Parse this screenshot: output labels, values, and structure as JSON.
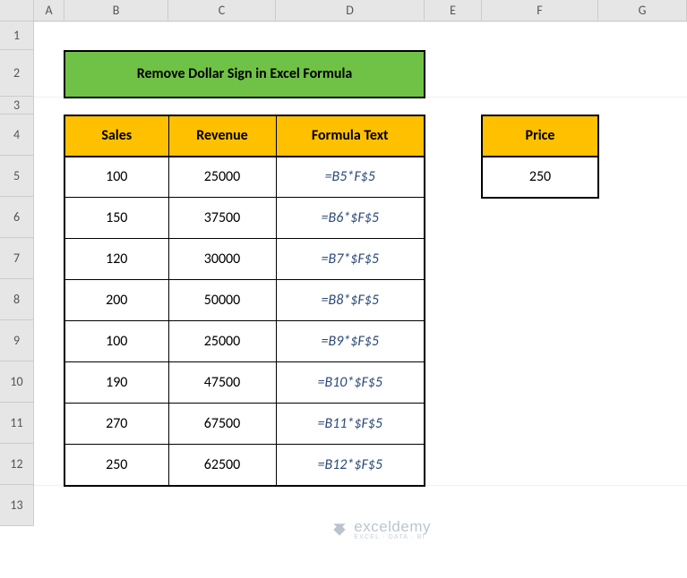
{
  "columns": [
    "A",
    "B",
    "C",
    "D",
    "E",
    "F",
    "G"
  ],
  "rows": [
    "1",
    "2",
    "3",
    "4",
    "5",
    "6",
    "7",
    "8",
    "9",
    "10",
    "11",
    "12",
    "13"
  ],
  "title": "Remove Dollar Sign in Excel Formula",
  "headers": {
    "sales": "Sales",
    "revenue": "Revenue",
    "formula_text": "Formula Text",
    "price": "Price"
  },
  "price_value": "250",
  "chart_data": {
    "type": "table",
    "title": "Remove Dollar Sign in Excel Formula",
    "columns": [
      "Sales",
      "Revenue",
      "Formula Text"
    ],
    "rows": [
      {
        "sales": 100,
        "revenue": 25000,
        "formula": "=B5*F$5"
      },
      {
        "sales": 150,
        "revenue": 37500,
        "formula": "=B6*$F$5"
      },
      {
        "sales": 120,
        "revenue": 30000,
        "formula": "=B7*$F$5"
      },
      {
        "sales": 200,
        "revenue": 50000,
        "formula": "=B8*$F$5"
      },
      {
        "sales": 100,
        "revenue": 25000,
        "formula": "=B9*$F$5"
      },
      {
        "sales": 190,
        "revenue": 47500,
        "formula": "=B10*$F$5"
      },
      {
        "sales": 270,
        "revenue": 67500,
        "formula": "=B11*$F$5"
      },
      {
        "sales": 250,
        "revenue": 62500,
        "formula": "=B12*$F$5"
      }
    ],
    "price": 250
  },
  "watermark": {
    "brand": "exceldemy",
    "tag": "EXCEL · DATA · BI"
  }
}
